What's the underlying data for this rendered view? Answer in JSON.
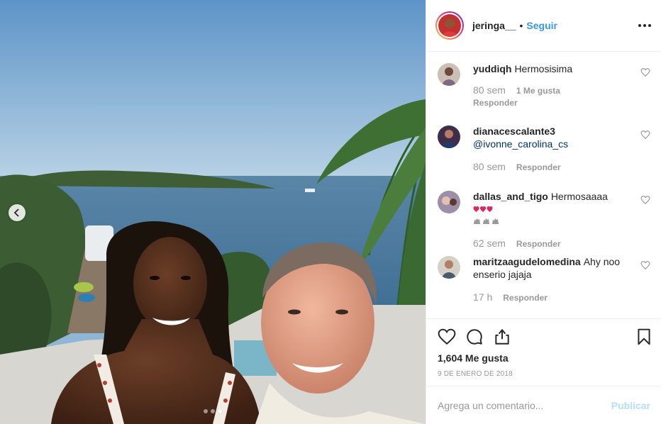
{
  "post": {
    "owner": "jeringa__",
    "separator": "•",
    "follow_label": "Seguir",
    "likes": "1,604 Me gusta",
    "date": "9 de enero de 2018",
    "comment_placeholder": "Agrega un comentario...",
    "publish_label": "Publicar"
  },
  "carousel": {
    "total": 3,
    "active": 3
  },
  "comments": [
    {
      "user": "yuddiqh",
      "text": "Hermosisima",
      "time": "80 sem",
      "likes": "1 Me gusta",
      "reply": "Responder"
    },
    {
      "user": "dianacescalante3",
      "text": "",
      "mention": "@ivonne_carolina_cs",
      "time": "80 sem",
      "reply": "Responder"
    },
    {
      "user": "dallas_and_tigo",
      "text": "Hermosaaaa",
      "time": "62 sem",
      "reply": "Responder"
    },
    {
      "user": "maritzaagudelomedina",
      "text": "Ahy noo enserio jajaja",
      "time": "17 h",
      "reply": "Responder"
    }
  ],
  "colors": {
    "accent": "#3897f0",
    "publish_disabled": "#b2dffc",
    "heart_emoji": "#e0245e",
    "text": "#262626",
    "muted": "#999999"
  },
  "icons": {
    "prev": "chevron-left-icon",
    "like": "heart-icon",
    "comment": "comment-bubble-icon",
    "share": "share-icon",
    "save": "bookmark-icon",
    "more": "more-options-icon"
  }
}
